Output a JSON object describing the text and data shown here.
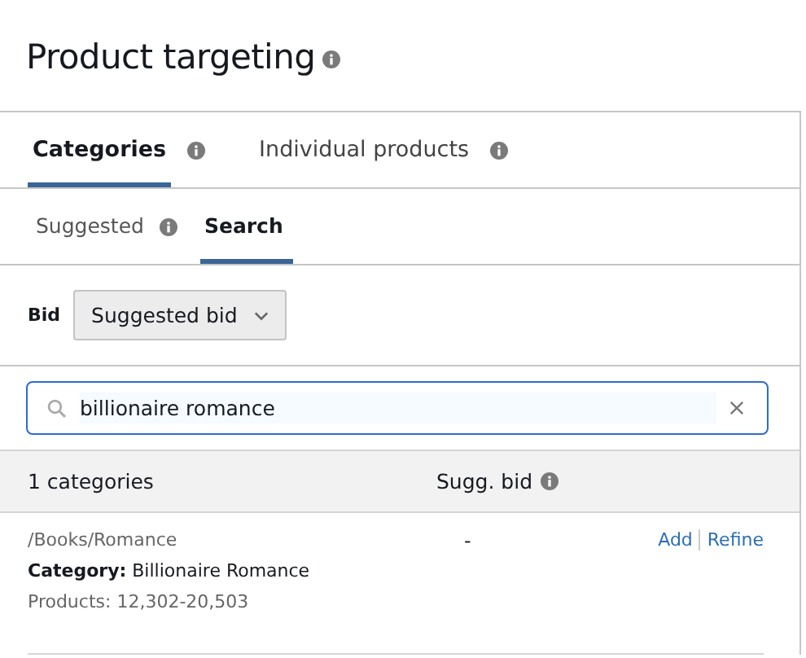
{
  "title": "Product targeting",
  "tabs": [
    {
      "label": "Categories",
      "selected": true
    },
    {
      "label": "Individual products",
      "selected": false
    }
  ],
  "subtabs": [
    {
      "label": "Suggested",
      "selected": false,
      "info": true
    },
    {
      "label": "Search",
      "selected": true,
      "info": false
    }
  ],
  "bid": {
    "label": "Bid",
    "value": "Suggested bid"
  },
  "search": {
    "value": "billionaire romance"
  },
  "table": {
    "columns": [
      "1 categories",
      "Sugg. bid"
    ],
    "rows": [
      {
        "path": "/Books/Romance",
        "category": "**Category:** Billionaire Romance",
        "products": "Products: 12,302-20,503",
        "bid": "-",
        "actions": [
          "Add",
          "Refine"
        ]
      }
    ]
  }
}
